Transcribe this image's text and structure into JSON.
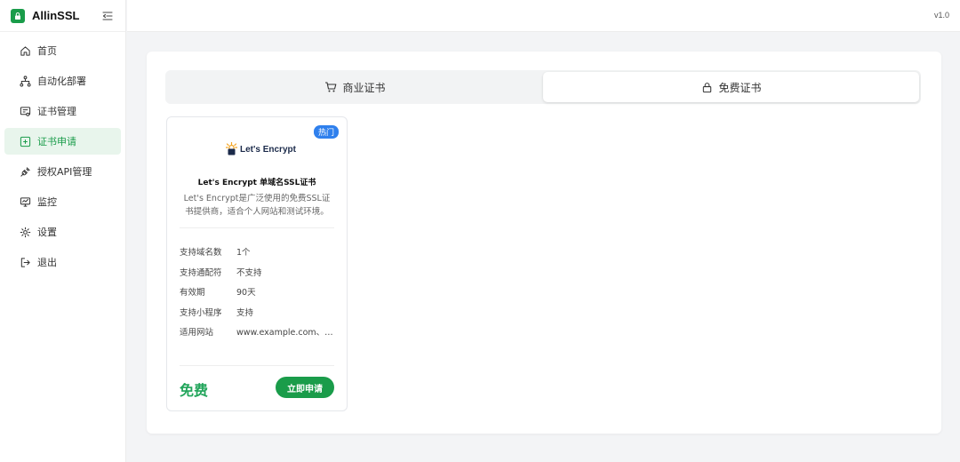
{
  "brand": {
    "name": "AllinSSL"
  },
  "header": {
    "version": "v1.0"
  },
  "sidebar": {
    "items": [
      {
        "label": "首页",
        "icon": "home-icon"
      },
      {
        "label": "自动化部署",
        "icon": "workflow-icon"
      },
      {
        "label": "证书管理",
        "icon": "certificate-icon"
      },
      {
        "label": "证书申请",
        "icon": "plus-square-icon",
        "active": true
      },
      {
        "label": "授权API管理",
        "icon": "api-plug-icon"
      },
      {
        "label": "监控",
        "icon": "monitor-icon"
      },
      {
        "label": "设置",
        "icon": "gear-icon"
      },
      {
        "label": "退出",
        "icon": "logout-icon"
      }
    ]
  },
  "tabs": [
    {
      "label": "商业证书",
      "icon": "cart-icon"
    },
    {
      "label": "免费证书",
      "icon": "lock-icon",
      "active": true
    }
  ],
  "card": {
    "badge": "热门",
    "logo_text": "Let's Encrypt",
    "title": "Let's Encrypt 单域名SSL证书",
    "description": "Let's Encrypt是广泛使用的免费SSL证书提供商，适合个人网站和测试环境。",
    "specs": [
      {
        "label": "支持域名数",
        "value": "1个"
      },
      {
        "label": "支持通配符",
        "value": "不支持"
      },
      {
        "label": "有效期",
        "value": "90天"
      },
      {
        "label": "支持小程序",
        "value": "支持"
      },
      {
        "label": "适用网站",
        "value": "www.example.com、ex…"
      }
    ],
    "price": "免费",
    "apply_label": "立即申请"
  },
  "colors": {
    "accent": "#1a9c4a",
    "badge": "#2f80ed",
    "price": "#22a55b"
  }
}
